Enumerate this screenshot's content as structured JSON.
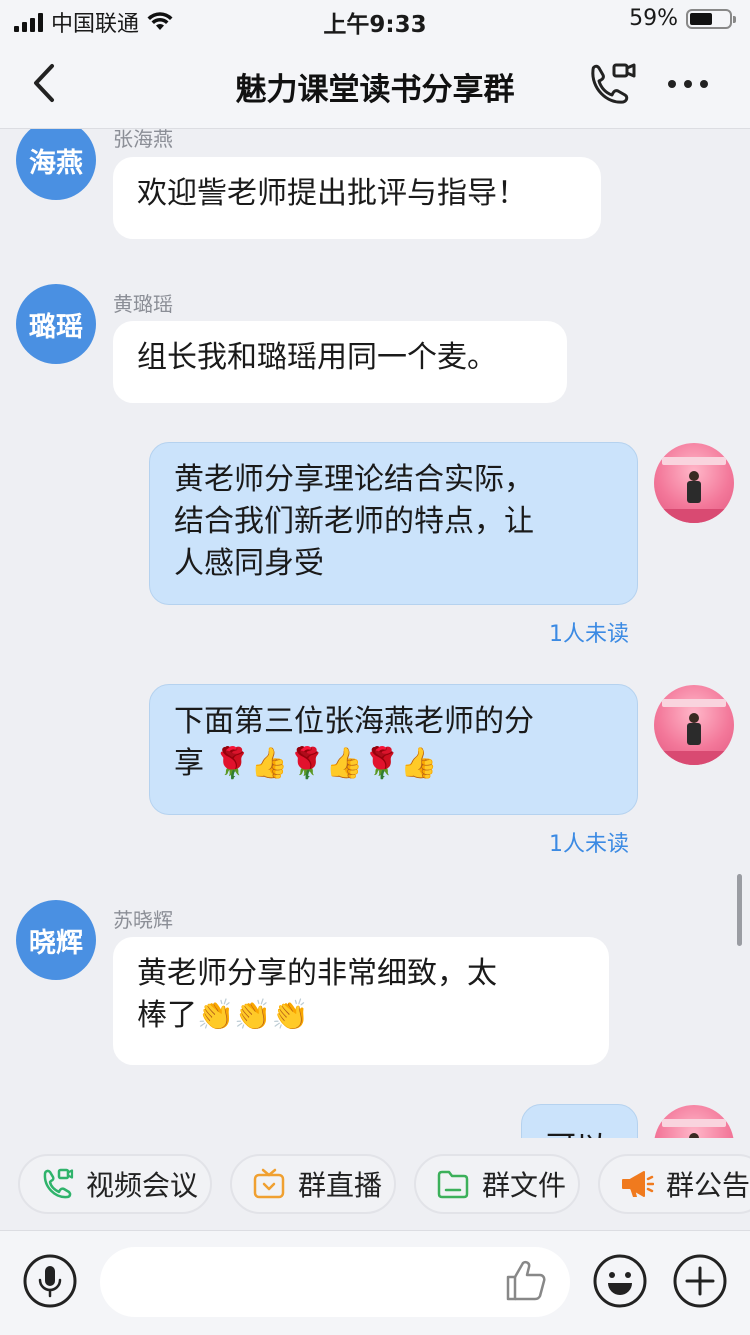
{
  "status_bar": {
    "carrier": "中国联通",
    "time": "上午9:33",
    "battery": "59%",
    "battery_level": 0.59
  },
  "nav": {
    "title": "魅力课堂读书分享群"
  },
  "messages": [
    {
      "sender": "张海燕",
      "avatar_text": "海燕",
      "text": "欢迎訾老师提出批评与指导！"
    },
    {
      "sender": "黄璐瑶",
      "avatar_text": "璐瑶",
      "text": "组长我和璐瑶用同一个麦。"
    },
    {
      "mine": true,
      "text_lines": [
        "黄老师分享理论结合实际，",
        "结合我们新老师的特点，让",
        "人感同身受"
      ],
      "status": "1人未读"
    },
    {
      "mine": true,
      "text_lines": [
        "下面第三位张海燕老师的分",
        "享"
      ],
      "emoji": "🌹👍🌹👍🌹👍",
      "status": "1人未读"
    },
    {
      "sender": "苏晓辉",
      "avatar_text": "晓辉",
      "text_lines": [
        "黄老师分享的非常细致，太",
        "棒了"
      ],
      "emoji": "👏👏👏"
    },
    {
      "mine": true,
      "text": "可以"
    }
  ],
  "quick_actions": [
    {
      "label": "视频会议",
      "icon": "video-call-icon",
      "color": "#2fb36b"
    },
    {
      "label": "群直播",
      "icon": "live-tv-icon",
      "color": "#f0a030"
    },
    {
      "label": "群文件",
      "icon": "folder-icon",
      "color": "#3cb05a"
    },
    {
      "label": "群公告",
      "icon": "megaphone-icon",
      "color": "#f07a1e"
    }
  ],
  "colors": {
    "accent": "#4a90e2",
    "my_bubble": "#cbe3fb",
    "unread": "#3b8ae3"
  }
}
